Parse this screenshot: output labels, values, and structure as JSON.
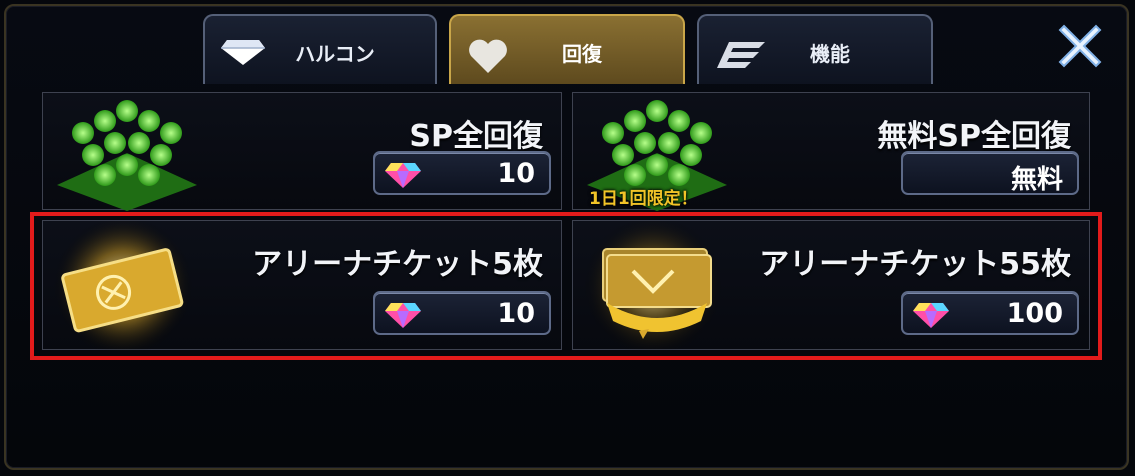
{
  "tabs": [
    {
      "label": "ハルコン",
      "icon": "diamond-icon"
    },
    {
      "label": "回復",
      "icon": "heart-icon"
    },
    {
      "label": "機能",
      "icon": "wing-icon"
    }
  ],
  "active_tab": "回復",
  "close_icon": "close-icon",
  "items": [
    {
      "title": "SP全回復",
      "price": "10",
      "currency_icon": "gem-icon"
    },
    {
      "title": "無料SP全回復",
      "price": "無料",
      "badge": "1日1回限定！"
    },
    {
      "title": "アリーナチケット5枚",
      "price": "10",
      "currency_icon": "gem-icon"
    },
    {
      "title": "アリーナチケット55枚",
      "price": "100",
      "currency_icon": "gem-icon"
    }
  ],
  "colors": {
    "accent_gold": "#c9a649",
    "highlight": "#e21b1b",
    "sp_green": "#57d23a"
  }
}
